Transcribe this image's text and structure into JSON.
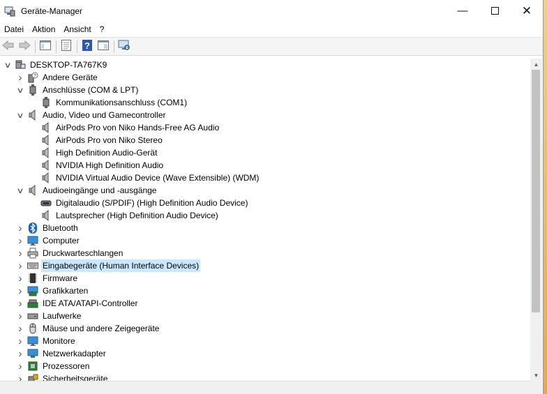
{
  "window": {
    "title": "Geräte-Manager"
  },
  "menu": [
    "Datei",
    "Aktion",
    "Ansicht",
    "?"
  ],
  "toolbar": [
    "back-icon",
    "forward-icon",
    "show-hide-console-tree-icon",
    "properties-icon",
    "help-icon",
    "update-driver-icon",
    "monitor-scan-icon"
  ],
  "tree": [
    {
      "label": "DESKTOP-TA767K9",
      "level": 0,
      "expander": "expanded",
      "icon": "computer-icon"
    },
    {
      "label": "Andere Geräte",
      "level": 1,
      "expander": "collapsed",
      "icon": "unknown-device-icon"
    },
    {
      "label": "Anschlüsse (COM & LPT)",
      "level": 1,
      "expander": "expanded",
      "icon": "port-icon"
    },
    {
      "label": "Kommunikationsanschluss (COM1)",
      "level": 2,
      "expander": "none",
      "icon": "port-icon"
    },
    {
      "label": "Audio, Video und Gamecontroller",
      "level": 1,
      "expander": "expanded",
      "icon": "speaker-icon"
    },
    {
      "label": "AirPods Pro von Niko Hands-Free AG Audio",
      "level": 2,
      "expander": "none",
      "icon": "speaker-icon"
    },
    {
      "label": "AirPods Pro von Niko Stereo",
      "level": 2,
      "expander": "none",
      "icon": "speaker-icon"
    },
    {
      "label": "High Definition Audio-Gerät",
      "level": 2,
      "expander": "none",
      "icon": "speaker-icon"
    },
    {
      "label": "NVIDIA High Definition Audio",
      "level": 2,
      "expander": "none",
      "icon": "speaker-icon"
    },
    {
      "label": "NVIDIA Virtual Audio Device (Wave Extensible) (WDM)",
      "level": 2,
      "expander": "none",
      "icon": "speaker-icon"
    },
    {
      "label": "Audioeingänge und -ausgänge",
      "level": 1,
      "expander": "expanded",
      "icon": "speaker-icon"
    },
    {
      "label": "Digitalaudio (S/PDIF) (High Definition Audio Device)",
      "level": 2,
      "expander": "none",
      "icon": "spdif-icon"
    },
    {
      "label": "Lautsprecher (High Definition Audio Device)",
      "level": 2,
      "expander": "none",
      "icon": "speaker-icon"
    },
    {
      "label": "Bluetooth",
      "level": 1,
      "expander": "collapsed",
      "icon": "bluetooth-icon"
    },
    {
      "label": "Computer",
      "level": 1,
      "expander": "collapsed",
      "icon": "monitor-icon"
    },
    {
      "label": "Druckwarteschlangen",
      "level": 1,
      "expander": "collapsed",
      "icon": "printer-icon"
    },
    {
      "label": "Eingabegeräte (Human Interface Devices)",
      "level": 1,
      "expander": "collapsed",
      "icon": "keyboard-icon",
      "selected": true
    },
    {
      "label": "Firmware",
      "level": 1,
      "expander": "collapsed",
      "icon": "chip-icon"
    },
    {
      "label": "Grafikkarten",
      "level": 1,
      "expander": "collapsed",
      "icon": "display-adapter-icon"
    },
    {
      "label": "IDE ATA/ATAPI-Controller",
      "level": 1,
      "expander": "collapsed",
      "icon": "ide-controller-icon"
    },
    {
      "label": "Laufwerke",
      "level": 1,
      "expander": "collapsed",
      "icon": "drive-icon"
    },
    {
      "label": "Mäuse und andere Zeigegeräte",
      "level": 1,
      "expander": "collapsed",
      "icon": "mouse-icon"
    },
    {
      "label": "Monitore",
      "level": 1,
      "expander": "collapsed",
      "icon": "monitor-icon"
    },
    {
      "label": "Netzwerkadapter",
      "level": 1,
      "expander": "collapsed",
      "icon": "network-adapter-icon"
    },
    {
      "label": "Prozessoren",
      "level": 1,
      "expander": "collapsed",
      "icon": "processor-icon"
    },
    {
      "label": "Sicherheitsgeräte",
      "level": 1,
      "expander": "collapsed",
      "icon": "security-device-icon"
    }
  ],
  "colors": {
    "selection": "#cce8ff",
    "accent": "#0078d7",
    "desktop": "#e9c67a"
  }
}
